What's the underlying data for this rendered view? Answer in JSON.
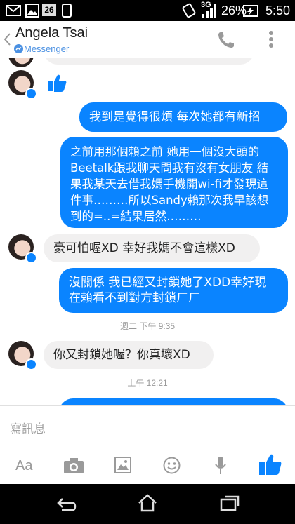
{
  "status_bar": {
    "notification_badge": "26",
    "network": "3G",
    "battery": "26%",
    "time": "5:50"
  },
  "header": {
    "contact_name": "Angela Tsai",
    "subtitle": "Messenger"
  },
  "messages": [
    {
      "text": "我到是覺得很煩 每次她都有新招"
    },
    {
      "text": "之前用那個賴之前 她用一個沒大頭的Beetalk跟我聊天問我有沒有女朋友 結果我某天去借我媽手機開wi-fi才發現這件事………所以Sandy賴那次我早該想到的=..=結果居然………"
    },
    {
      "text": "豪可怕喔XD 幸好我媽不會這樣XD"
    },
    {
      "text": "沒關係 我已經又封鎖她了XDD幸好現在賴看不到對方封鎖ㄏㄏ"
    },
    {
      "text": "你又封鎖她喔？你真壞XD"
    }
  ],
  "timestamps": [
    "週二 下午 9:35",
    "上午 12:21"
  ],
  "composer": {
    "placeholder": "寫訊息",
    "aa_label": "Aa"
  },
  "colors": {
    "accent": "#0a84ff",
    "incoming_bubble": "#f1f0f0"
  }
}
